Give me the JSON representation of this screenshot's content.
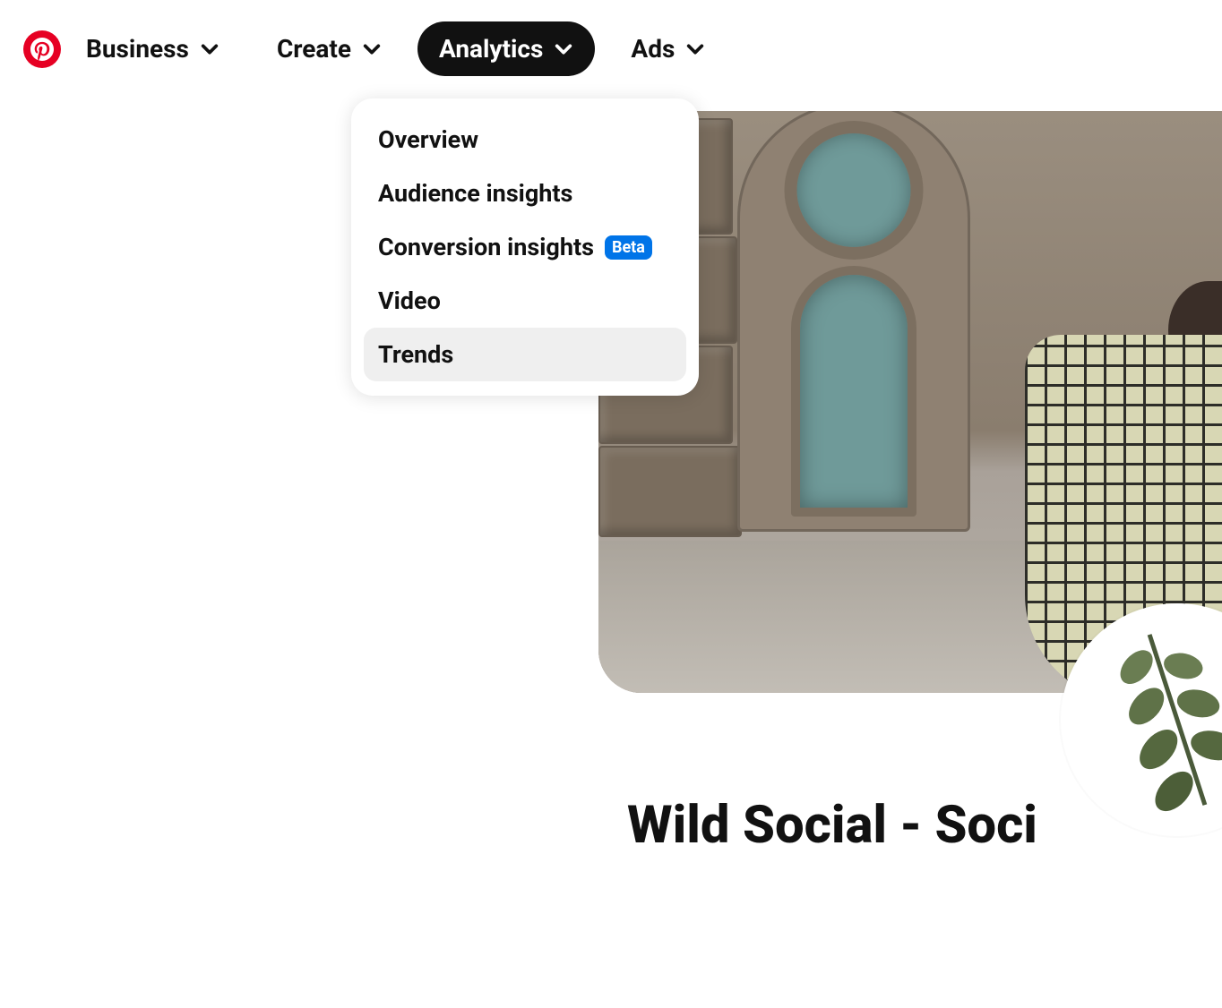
{
  "nav": {
    "items": [
      {
        "label": "Business",
        "active": false
      },
      {
        "label": "Create",
        "active": false
      },
      {
        "label": "Analytics",
        "active": true
      },
      {
        "label": "Ads",
        "active": false
      }
    ]
  },
  "analytics_menu": {
    "items": [
      {
        "label": "Overview",
        "badge": null,
        "hovered": false
      },
      {
        "label": "Audience insights",
        "badge": null,
        "hovered": false
      },
      {
        "label": "Conversion insights",
        "badge": "Beta",
        "hovered": false
      },
      {
        "label": "Video",
        "badge": null,
        "hovered": false
      },
      {
        "label": "Trends",
        "badge": null,
        "hovered": true
      }
    ]
  },
  "profile": {
    "title": "Wild Social - Soci"
  }
}
